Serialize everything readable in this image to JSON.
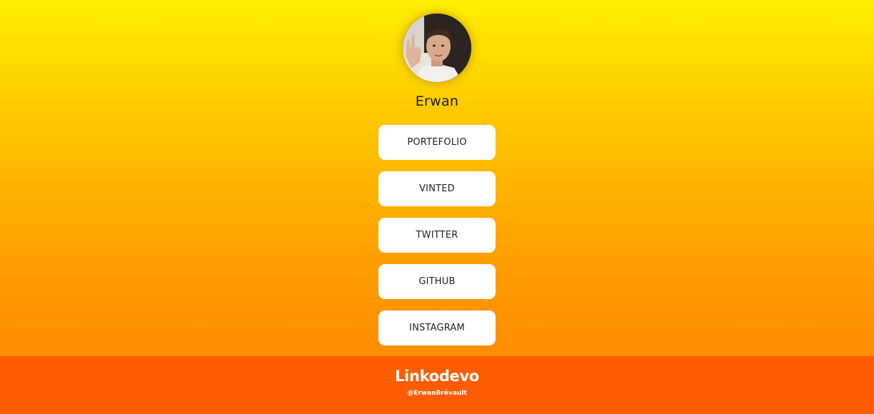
{
  "profile": {
    "name": "Erwan",
    "avatar_icon": "profile-photo"
  },
  "links": [
    {
      "label": "PORTEFOLIO"
    },
    {
      "label": "VINTED"
    },
    {
      "label": "TWITTER"
    },
    {
      "label": "GITHUB"
    },
    {
      "label": "INSTAGRAM"
    }
  ],
  "footer": {
    "brand": "Linkodevo",
    "handle": "@ErwanBrévault"
  },
  "colors": {
    "gradient_top": "#ffef00",
    "gradient_bottom": "#ff8200",
    "footer_bg": "#ff5c00",
    "button_bg": "#ffffff"
  }
}
